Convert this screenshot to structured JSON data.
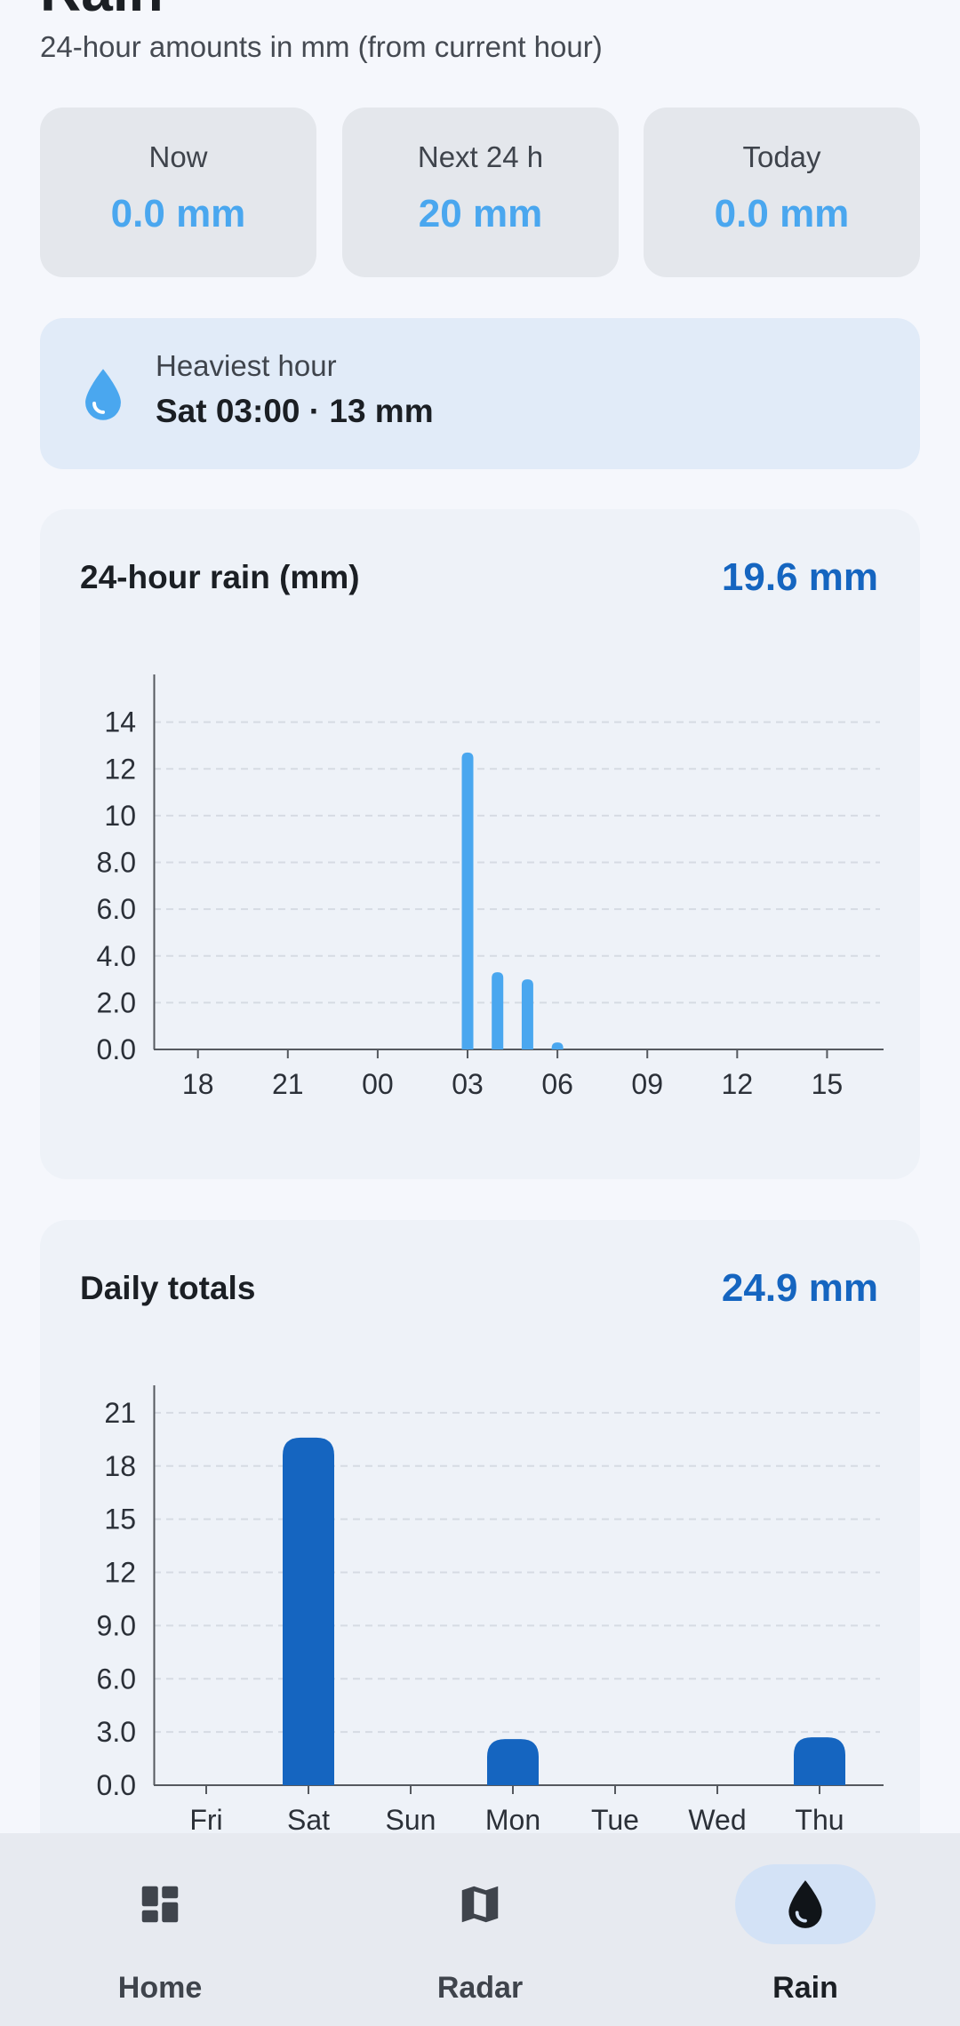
{
  "header": {
    "title": "Rain",
    "subtitle": "24-hour amounts in mm (from current hour)"
  },
  "stats": [
    {
      "label": "Now",
      "value": "0.0 mm"
    },
    {
      "label": "Next 24 h",
      "value": "20 mm"
    },
    {
      "label": "Today",
      "value": "0.0 mm"
    }
  ],
  "heaviest": {
    "label": "Heaviest hour",
    "value": "Sat 03:00 · 13 mm",
    "icon": "water-drop-icon"
  },
  "hourly_card": {
    "title": "24-hour rain (mm)",
    "total": "19.6 mm"
  },
  "daily_card": {
    "title": "Daily totals",
    "total": "24.9 mm"
  },
  "chart_data": [
    {
      "type": "bar",
      "title": "24-hour rain (mm)",
      "x": [
        17,
        18,
        19,
        20,
        21,
        22,
        23,
        0,
        1,
        2,
        3,
        4,
        5,
        6,
        7,
        8,
        9,
        10,
        11,
        12,
        13,
        14,
        15,
        16
      ],
      "tick_labels": [
        "18",
        "21",
        "00",
        "03",
        "06",
        "09",
        "12",
        "15"
      ],
      "tick_hours": [
        18,
        21,
        0,
        3,
        6,
        9,
        12,
        15
      ],
      "values": [
        0,
        0,
        0,
        0,
        0,
        0,
        0,
        0,
        0,
        0,
        12.7,
        3.3,
        3.0,
        0.3,
        0,
        0,
        0,
        0,
        0,
        0,
        0,
        0,
        0,
        0
      ],
      "yticks": [
        "0.0",
        "2.0",
        "4.0",
        "6.0",
        "8.0",
        "10",
        "12",
        "14"
      ],
      "ylim": [
        0,
        16
      ],
      "grid": true,
      "color": "#4aa7ef"
    },
    {
      "type": "bar",
      "title": "Daily totals",
      "categories": [
        "Fri",
        "Sat",
        "Sun",
        "Mon",
        "Tue",
        "Wed",
        "Thu"
      ],
      "values": [
        0,
        19.6,
        0,
        2.6,
        0,
        0,
        2.7
      ],
      "yticks": [
        "0.0",
        "3.0",
        "6.0",
        "9.0",
        "12",
        "15",
        "18",
        "21"
      ],
      "ylim": [
        0,
        22.5
      ],
      "grid": true,
      "color": "#1565c0"
    }
  ],
  "nav": {
    "items": [
      {
        "label": "Home",
        "icon": "dashboard-icon"
      },
      {
        "label": "Radar",
        "icon": "map-icon"
      },
      {
        "label": "Rain",
        "icon": "water-drop-icon",
        "active": true
      }
    ]
  },
  "colors": {
    "accent_light": "#4aa7ef",
    "accent_dark": "#1565c0",
    "background": "#f5f7fc",
    "card": "#eef2f8"
  }
}
